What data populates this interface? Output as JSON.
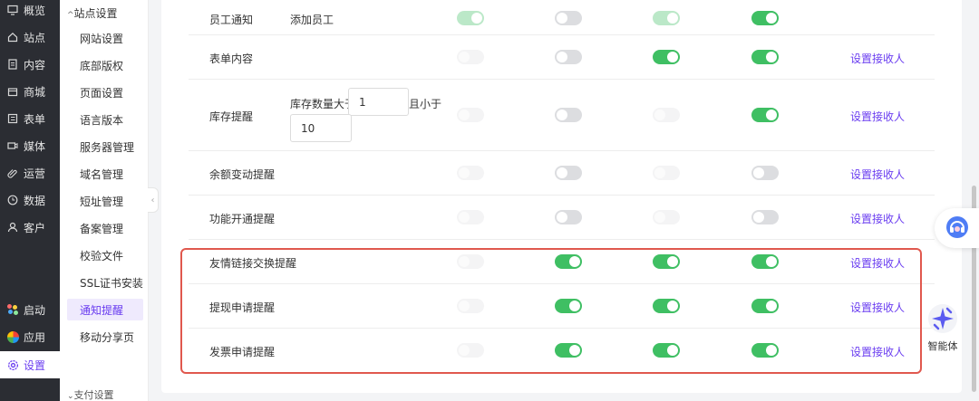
{
  "main_nav": [
    {
      "label": "概览",
      "icon": "monitor-icon",
      "active": false
    },
    {
      "label": "站点",
      "icon": "home-icon",
      "active": false
    },
    {
      "label": "内容",
      "icon": "document-icon",
      "active": false
    },
    {
      "label": "商城",
      "icon": "shop-icon",
      "active": false
    },
    {
      "label": "表单",
      "icon": "form-icon",
      "active": false
    },
    {
      "label": "媒体",
      "icon": "video-icon",
      "active": false
    },
    {
      "label": "运营",
      "icon": "paperclip-icon",
      "active": false
    },
    {
      "label": "数据",
      "icon": "clock-icon",
      "active": false
    },
    {
      "label": "客户",
      "icon": "user-icon",
      "active": false
    }
  ],
  "bottom_nav": [
    {
      "label": "启动",
      "icon": "launch-dots-icon"
    },
    {
      "label": "应用",
      "icon": "apps-pinwheel-icon"
    },
    {
      "label": "设置",
      "icon": "gear-icon",
      "active": true
    }
  ],
  "sub_nav": {
    "group_title": "站点设置",
    "items": [
      "网站设置",
      "底部版权",
      "页面设置",
      "语言版本",
      "服务器管理",
      "域名管理",
      "短址管理",
      "备案管理",
      "校验文件",
      "SSL证书安装",
      "通知提醒",
      "移动分享页"
    ],
    "active_index": 10,
    "next_group": "支付设置"
  },
  "rows": [
    {
      "label": "员工通知",
      "extra": "添加员工",
      "switches": [
        "on-faded",
        "off",
        "on-faded",
        "on"
      ],
      "link": ""
    },
    {
      "label": "表单内容",
      "extra": "",
      "switches": [
        "ghost",
        "off",
        "on",
        "on"
      ],
      "link": "设置接收人"
    },
    {
      "label": "库存提醒",
      "extra": "",
      "switches": [
        "ghost",
        "off",
        "ghost",
        "on"
      ],
      "link": "设置接收人",
      "stock": {
        "prefix": "库存数量大于",
        "min_value": "1",
        "middle": "且小于",
        "max_value": "10"
      }
    },
    {
      "label": "余额变动提醒",
      "extra": "",
      "switches": [
        "ghost",
        "off",
        "ghost",
        "off"
      ],
      "link": "设置接收人"
    },
    {
      "label": "功能开通提醒",
      "extra": "",
      "switches": [
        "ghost",
        "off",
        "ghost",
        "off"
      ],
      "link": "设置接收人"
    },
    {
      "label": "友情链接交换提醒",
      "extra": "",
      "switches": [
        "ghost",
        "on",
        "on",
        "on"
      ],
      "link": "设置接收人"
    },
    {
      "label": "提现申请提醒",
      "extra": "",
      "switches": [
        "ghost",
        "on",
        "on",
        "on"
      ],
      "link": "设置接收人"
    },
    {
      "label": "发票申请提醒",
      "extra": "",
      "switches": [
        "ghost",
        "on",
        "on",
        "on"
      ],
      "link": "设置接收人"
    }
  ],
  "agent": {
    "label": "智能体"
  },
  "colors": {
    "accent": "#6a3df0",
    "switch_on": "#3fbf63",
    "highlight_border": "#e0584e",
    "nav_bg": "#2b2d33"
  }
}
